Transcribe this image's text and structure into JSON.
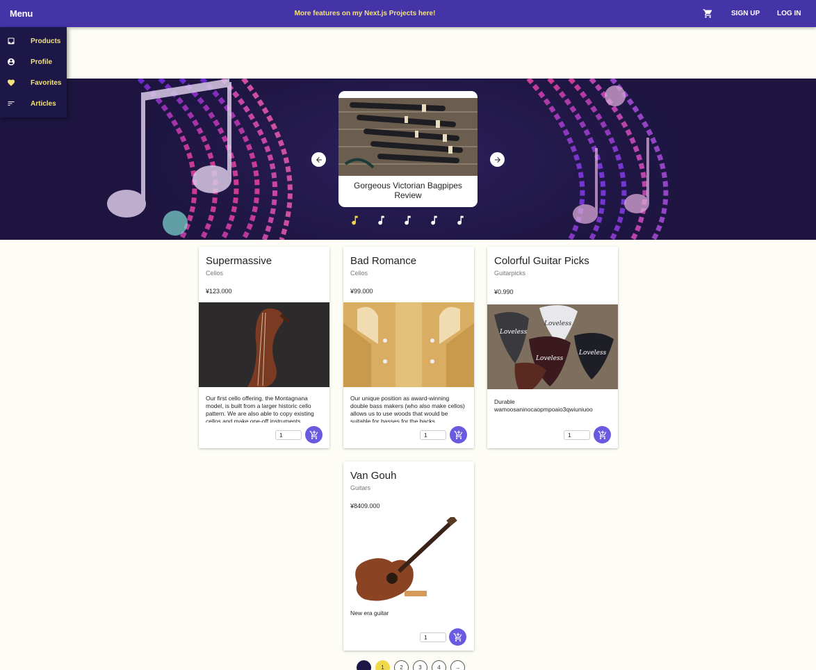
{
  "appbar": {
    "menu_label": "Menu",
    "promo_text": "More features on my Next.js Projects here!",
    "signup_label": "SIGN UP",
    "login_label": "LOG IN",
    "cart_icon": "shopping-cart-icon"
  },
  "drawer": {
    "items": [
      {
        "label": "Products",
        "icon": "inbox-icon"
      },
      {
        "label": "Profile",
        "icon": "account-circle-icon"
      },
      {
        "label": "Favorites",
        "icon": "heart-icon"
      },
      {
        "label": "Articles",
        "icon": "sort-list-icon"
      }
    ]
  },
  "carousel": {
    "slide_title": "Gorgeous Victorian Bagpipes Review",
    "slide_count": 5,
    "active_index": 0,
    "prev_icon": "arrow-left-icon",
    "next_icon": "arrow-right-icon"
  },
  "products": [
    {
      "name": "Supermassive",
      "category": "Cellos",
      "price": "¥123.000",
      "description": "Our first cello offering, the Montagnana model, is built from a larger historic cello pattern. We are also able to copy existing cellos and make one-off instruments.",
      "qty": "1"
    },
    {
      "name": "Bad Romance",
      "category": "Cellos",
      "price": "¥99.000",
      "description": "Our unique position as award-winning double bass makers (who also make cellos) allows us to use woods that would be suitable for basses for the backs.",
      "qty": "1"
    },
    {
      "name": "Colorful Guitar Picks",
      "category": "Guitarpicks",
      "price": "¥0.990",
      "description": "Durable wamoosaninocaopmpoaio3qwiuniuoo",
      "qty": "1"
    },
    {
      "name": "Van Gouh",
      "category": "Guitars",
      "price": "¥8409.000",
      "description": "New era guitar",
      "qty": "1"
    }
  ],
  "pagination": {
    "pages": [
      "1",
      "2",
      "3",
      "4"
    ],
    "active": "1",
    "next_label": "→"
  },
  "colors": {
    "appbar": "#4434a8",
    "accent_yellow": "#f5e27a",
    "add_button": "#6a5ae0",
    "drawer": "#1c1747"
  }
}
